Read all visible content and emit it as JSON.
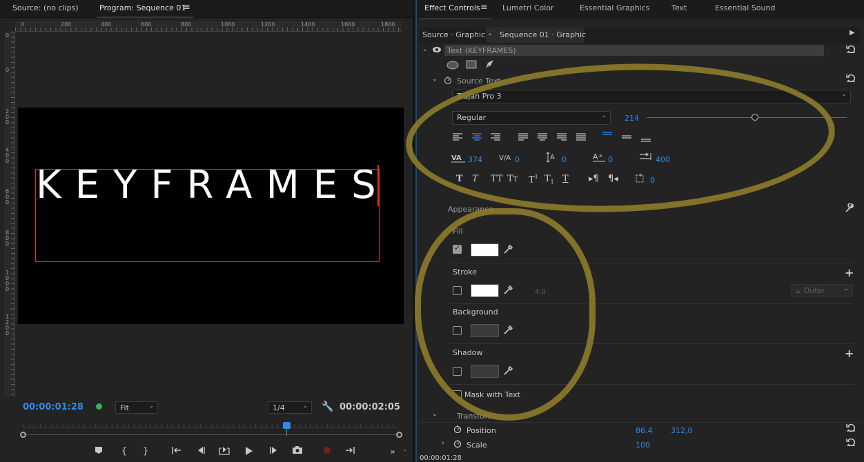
{
  "left_panel": {
    "tabs": [
      "Source: (no clips)",
      "Program: Sequence 01"
    ],
    "program_menu_icon": "hamburger-icon",
    "ruler_top_labels": [
      "0",
      "200",
      "400",
      "600",
      "800",
      "1000",
      "1200",
      "1400",
      "1600",
      "1800"
    ],
    "ruler_left_labels": [
      "0",
      "0",
      "200",
      "0",
      "400",
      "0",
      "600",
      "0",
      "800",
      "0",
      "1000",
      "1200"
    ],
    "title_text": "KEYFRAMES",
    "current_timecode": "00:00:01:28",
    "zoom_value": "Fit",
    "resolution_value": "1/4",
    "duration_timecode": "00:00:02:05",
    "transport_icons": [
      "marker-icon",
      "mark-in-icon",
      "mark-out-icon",
      "go-to-in-icon",
      "step-back-icon",
      "play-in-to-out-icon",
      "play-icon",
      "step-forward-icon",
      "export-frame-icon",
      "record-icon",
      "insert-icon",
      "more-icon"
    ]
  },
  "right_panel": {
    "tabs": [
      "Effect Controls",
      "Lumetri Color",
      "Essential Graphics",
      "Text",
      "Essential Sound"
    ],
    "source_crumb": "Source · Graphic",
    "sequence_crumb": "Sequence 01 · Graphic",
    "text_layer": "Text (KEYFRAMES)",
    "source_text_label": "Source Text",
    "font_name": "Trajan Pro 3",
    "font_style": "Regular",
    "font_size": "214",
    "tracking": "374",
    "kerning": "0",
    "leading": "0",
    "baseline": "0",
    "tsume": "400",
    "tab_width": "0",
    "appearance_label": "Appearance",
    "fill_label": "Fill",
    "fill_checked": true,
    "fill_color": "#ffffff",
    "stroke_label": "Stroke",
    "stroke_checked": false,
    "stroke_color": "#ffffff",
    "stroke_width": "4,0",
    "stroke_type": "Outer",
    "background_label": "Background",
    "background_checked": false,
    "shadow_label": "Shadow",
    "shadow_checked": false,
    "mask_label": "Mask with Text",
    "transform_label": "Transform",
    "position_label": "Position",
    "position_x": "86,4",
    "position_y": "312,0",
    "scale_label": "Scale",
    "scale_value": "100",
    "footer_timecode": "00:00:01:28"
  },
  "colors": {
    "accent": "#2d8ceb",
    "annotation": "#8b7a2b",
    "text_box_border": "#e0302a"
  }
}
